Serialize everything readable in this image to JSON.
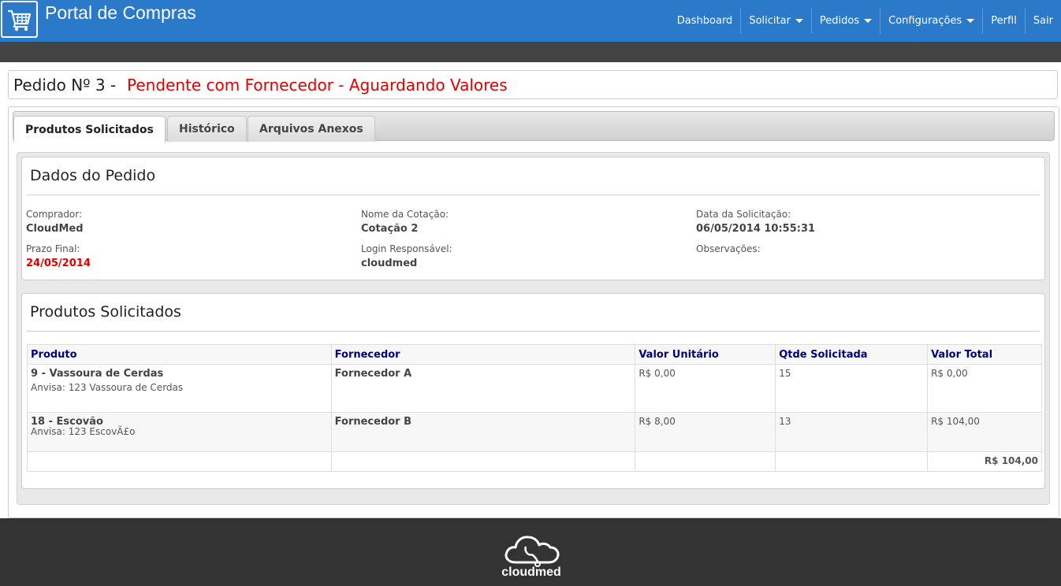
{
  "header": {
    "app_title": "Portal de Compras",
    "logo_icon": "shopping-cart-icon",
    "nav": [
      {
        "label": "Dashboard",
        "dropdown": false
      },
      {
        "label": "Solicitar",
        "dropdown": true
      },
      {
        "label": "Pedidos",
        "dropdown": true
      },
      {
        "label": "Configurações",
        "dropdown": true
      },
      {
        "label": "Perfil",
        "dropdown": false
      },
      {
        "label": "Sair",
        "dropdown": false
      }
    ]
  },
  "order": {
    "title_prefix": "Pedido Nº 3 -",
    "status": "Pendente com Fornecedor - Aguardando Valores",
    "status_color": "#e10000"
  },
  "tabs": [
    {
      "label": "Produtos Solicitados",
      "active": true
    },
    {
      "label": "Histórico",
      "active": false
    },
    {
      "label": "Arquivos Anexos",
      "active": false
    }
  ],
  "order_data": {
    "title": "Dados do Pedido",
    "fields": {
      "comprador": {
        "label": "Comprador:",
        "value": "CloudMed"
      },
      "nome_cotacao": {
        "label": "Nome da Cotação:",
        "value": "Cotação 2"
      },
      "data_solicitacao": {
        "label": "Data da Solicitação:",
        "value": "06/05/2014 10:55:31"
      },
      "prazo_final": {
        "label": "Prazo Final:",
        "value": "24/05/2014"
      },
      "login_responsavel": {
        "label": "Login Responsável:",
        "value": "cloudmed"
      },
      "observacoes": {
        "label": "Observações:",
        "value": ""
      }
    }
  },
  "products": {
    "title": "Produtos Solicitados",
    "columns": [
      "Produto",
      "Fornecedor",
      "Valor Unitário",
      "Qtde Solicitada",
      "Valor Total"
    ],
    "rows": [
      {
        "name": "9 - Vassoura de Cerdas",
        "anvisa": "Anvisa: 123 Vassoura de Cerdas",
        "supplier": "Fornecedor A",
        "unit": "R$ 0,00",
        "qty": "15",
        "total": "R$ 0,00"
      },
      {
        "name": "18 - Escovão",
        "anvisa": "Anvisa: 123 EscovÃ£o",
        "supplier": "Fornecedor B",
        "unit": "R$ 8,00",
        "qty": "13",
        "total": "R$ 104,00"
      }
    ],
    "grand_total": "R$ 104,00"
  },
  "footer": {
    "logo_icon": "cloud-stethoscope-icon",
    "brand": "cloudmed"
  }
}
